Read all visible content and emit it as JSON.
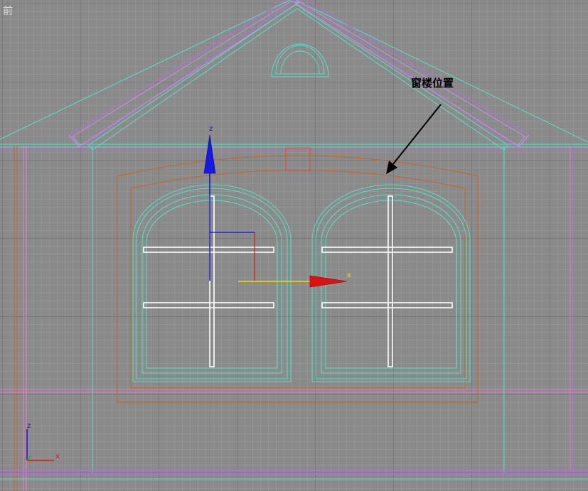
{
  "viewport": {
    "label": "前"
  },
  "annotation": {
    "label": "窗楼位置"
  },
  "gizmo": {
    "z_label": "z",
    "x_label": "x"
  },
  "axis_tripod": {
    "z_label": "z",
    "x_label": "x"
  },
  "colors": {
    "background": "#8a8a8a",
    "grid_minor": "#9a9a9a",
    "grid_major": "#6e6e6e",
    "cyan_wire": "#55e0c8",
    "purple_wire": "#b070d8",
    "orange_wire": "#c06a30",
    "white_bars": "#ffffff",
    "gizmo_z": "#1010d0",
    "gizmo_x": "#e01010",
    "gizmo_y": "#f0e000"
  }
}
